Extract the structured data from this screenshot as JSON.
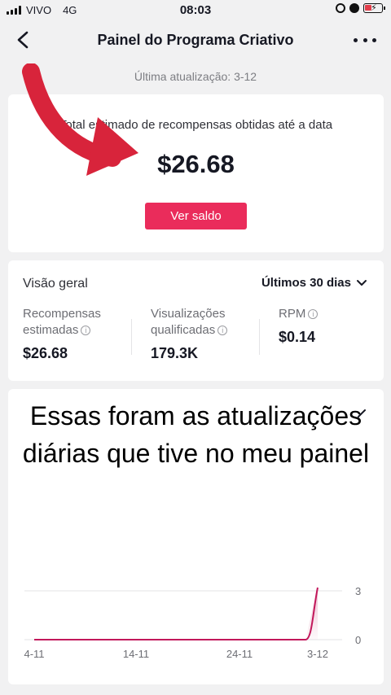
{
  "status_bar": {
    "carrier": "VIVO",
    "network": "4G",
    "time": "08:03"
  },
  "nav": {
    "title": "Painel do Programa Criativo",
    "back_icon": "chevron-left-icon",
    "more_icon": "more-dots-icon"
  },
  "last_update": "Última atualização: 3-12",
  "rewards": {
    "label": "Total estimado de recompensas obtidas até a data",
    "value": "$26.68",
    "balance_button": "Ver saldo"
  },
  "overview": {
    "title": "Visão geral",
    "period": "Últimos 30 dias",
    "metrics": [
      {
        "line1": "Recompensas",
        "line2": "estimadas",
        "value": "$26.68"
      },
      {
        "line1": "Visualizações",
        "line2": "qualificadas",
        "value": "179.3K"
      },
      {
        "line1": "RPM",
        "line2": "",
        "value": "$0.14"
      }
    ]
  },
  "overlay_caption": "Essas foram as atualizações diárias que tive no meu painel",
  "colors": {
    "accent": "#ea2c5b",
    "arrow": "#d8243b",
    "line": "#c2185b"
  },
  "chart_data": {
    "type": "line",
    "x_ticks": [
      "4-11",
      "14-11",
      "24-11",
      "3-12"
    ],
    "y_ticks": [
      "3",
      "0"
    ],
    "ylim": [
      0,
      3
    ],
    "series": [
      {
        "x": [
          "4-11",
          "14-11",
          "24-11",
          "2-12",
          "3-12"
        ],
        "values": [
          0,
          0,
          0,
          0,
          3.2
        ]
      }
    ]
  }
}
